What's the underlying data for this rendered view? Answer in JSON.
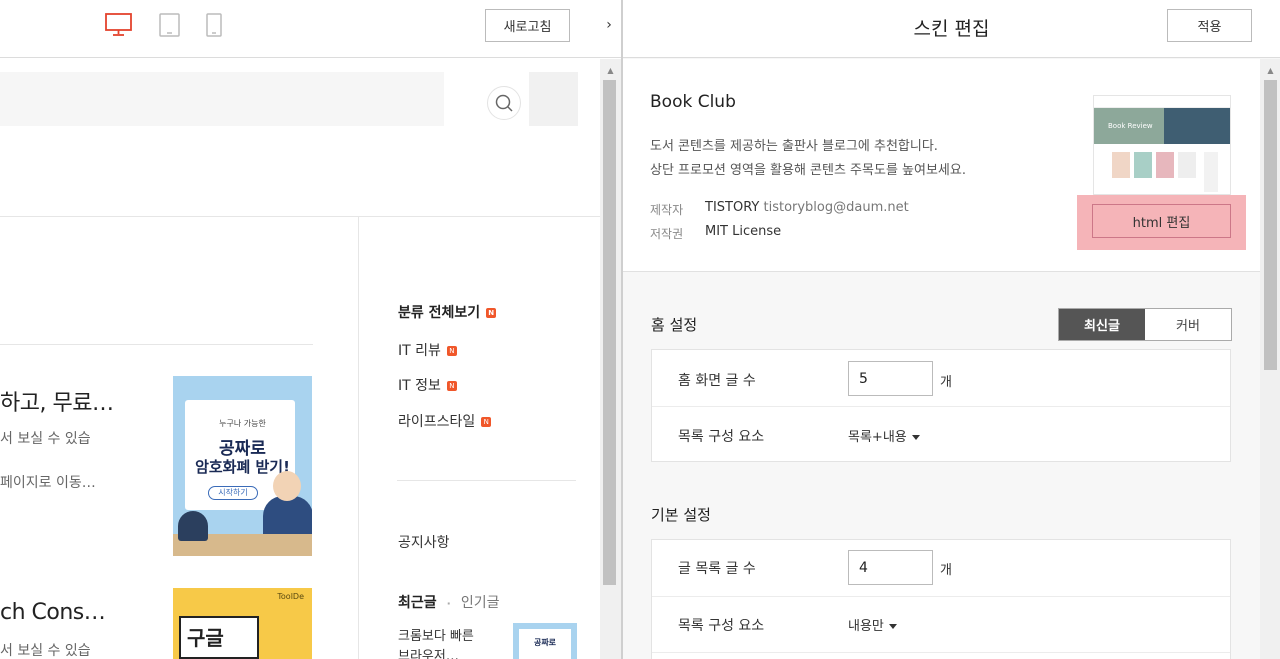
{
  "left_toolbar": {
    "devices": [
      {
        "name": "desktop",
        "icon": "monitor-icon",
        "active": true
      },
      {
        "name": "tablet",
        "icon": "tablet-icon",
        "active": false
      },
      {
        "name": "mobile",
        "icon": "phone-icon",
        "active": false
      }
    ],
    "refresh_label": "새로고침",
    "collapse_glyph": "›"
  },
  "preview": {
    "posts": [
      {
        "title": "하고, 무료…",
        "line1": "서 보실 수 있습",
        "line2": "페이지로 이동…",
        "thumb": {
          "top_text": "누구나 가능한",
          "main1": "공짜로",
          "main2": "암호화폐 받기!",
          "button": "시작하기"
        }
      },
      {
        "title": "ch Cons…",
        "line1": "서 보실 수 있습",
        "thumb": {
          "brand": "ToolDe",
          "main": "구글"
        }
      }
    ],
    "sidebar": {
      "category_all": "분류 전체보기",
      "categories": [
        "IT 리뷰",
        "IT 정보",
        "라이프스타일"
      ],
      "notice": "공지사항",
      "tab_recent": "최근글",
      "tab_popular": "인기글",
      "recent_line1": "크롬보다 빠른",
      "recent_line2": "브라우저…",
      "recent_thumb_text": "공짜로"
    },
    "badge": "N"
  },
  "panel": {
    "title": "스킨 편집",
    "apply_label": "적용",
    "skin": {
      "name": "Book Club",
      "desc1": "도서 콘텐츠를 제공하는 출판사 블로그에 추천합니다.",
      "desc2": "상단 프로모션 영역을 활용해 콘텐츠 주목도를 높여보세요.",
      "maker_label": "제작자",
      "maker_value": "TISTORY",
      "maker_email": "tistoryblog@daum.net",
      "license_label": "저작권",
      "license_value": "MIT License",
      "html_edit_label": "html 편집",
      "preview_banner_text": "Book Review"
    },
    "home_settings": {
      "title": "홈 설정",
      "toggle": [
        "최신글",
        "커버"
      ],
      "toggle_active": "최신글",
      "rows": [
        {
          "label": "홈 화면 글 수",
          "value": "5",
          "unit": "개"
        },
        {
          "label": "목록 구성 요소",
          "select": "목록+내용"
        }
      ]
    },
    "basic_settings": {
      "title": "기본 설정",
      "rows": [
        {
          "label": "글 목록 글 수",
          "value": "4",
          "unit": "개"
        },
        {
          "label": "목록 구성 요소",
          "select": "내용만"
        }
      ]
    }
  },
  "colors": {
    "accent_red": "#e4432d",
    "badge_orange": "#f0572a",
    "highlight_pink": "#f5b4b8",
    "toggle_active": "#555555"
  }
}
